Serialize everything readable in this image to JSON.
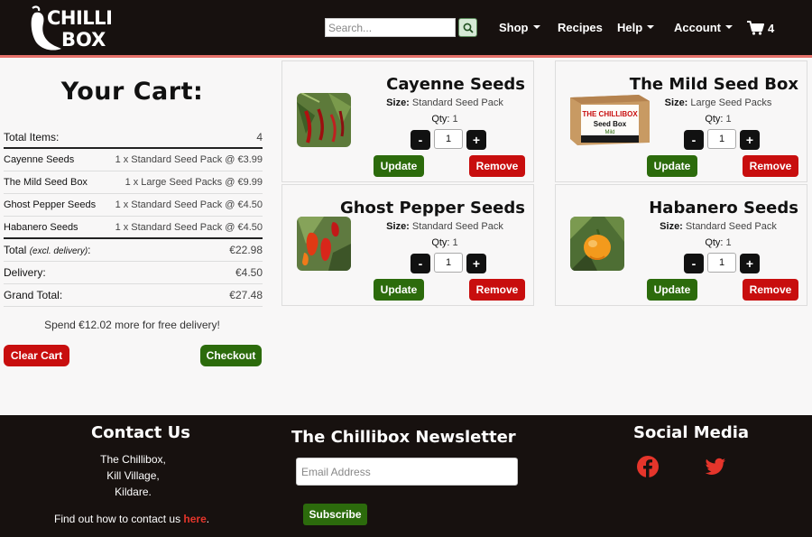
{
  "brand": {
    "logo_top": "CHILLI",
    "logo_bottom": "BOX"
  },
  "search": {
    "placeholder": "Search..."
  },
  "nav": {
    "shop": "Shop",
    "recipes": "Recipes",
    "help": "Help",
    "account": "Account",
    "cart_count": "4"
  },
  "cart": {
    "title": "Your Cart:",
    "total_items_label": "Total Items:",
    "total_items": "4",
    "lines": [
      {
        "name": "Cayenne Seeds",
        "detail": "1 x Standard Seed Pack @ €3.99"
      },
      {
        "name": "The Mild Seed Box",
        "detail": "1 x Large Seed Packs @ €9.99"
      },
      {
        "name": "Ghost Pepper Seeds",
        "detail": "1 x Standard Seed Pack @ €4.50"
      },
      {
        "name": "Habanero Seeds",
        "detail": "1 x Standard Seed Pack @ €4.50"
      }
    ],
    "total_label": "Total",
    "total_note": "(excl. delivery)",
    "total_suffix": ":",
    "total": "€22.98",
    "delivery_label": "Delivery:",
    "delivery": "€4.50",
    "grand_label": "Grand Total:",
    "grand": "€27.48",
    "free_delivery_msg": "Spend €12.02 more for free delivery!",
    "clear_label": "Clear Cart",
    "checkout_label": "Checkout"
  },
  "products": [
    {
      "name": "Cayenne Seeds",
      "size_label": "Size:",
      "size": "Standard Seed Pack",
      "qty_label": "Qty:",
      "qty": "1",
      "qty_input": "1",
      "minus": "-",
      "plus": "+",
      "update": "Update",
      "remove": "Remove"
    },
    {
      "name": "The Mild Seed Box",
      "size_label": "Size:",
      "size": "Large Seed Packs",
      "qty_label": "Qty:",
      "qty": "1",
      "qty_input": "1",
      "minus": "-",
      "plus": "+",
      "update": "Update",
      "remove": "Remove",
      "box_title": "THE CHILLIBOX",
      "box_sub": "Seed Box",
      "box_tag": "Mild"
    },
    {
      "name": "Ghost Pepper Seeds",
      "size_label": "Size:",
      "size": "Standard Seed Pack",
      "qty_label": "Qty:",
      "qty": "1",
      "qty_input": "1",
      "minus": "-",
      "plus": "+",
      "update": "Update",
      "remove": "Remove"
    },
    {
      "name": "Habanero Seeds",
      "size_label": "Size:",
      "size": "Standard Seed Pack",
      "qty_label": "Qty:",
      "qty": "1",
      "qty_input": "1",
      "minus": "-",
      "plus": "+",
      "update": "Update",
      "remove": "Remove"
    }
  ],
  "footer": {
    "contact_title": "Contact Us",
    "address": [
      "The Chillibox,",
      "Kill Village,",
      "Kildare."
    ],
    "contact_prefix": "Find out how to contact us ",
    "contact_link": "here",
    "contact_suffix": ".",
    "newsletter_title": "The Chillibox Newsletter",
    "email_placeholder": "Email Address",
    "subscribe": "Subscribe",
    "social_title": "Social Media",
    "social_icons": [
      "facebook-icon",
      "twitter-icon"
    ]
  },
  "colors": {
    "header_bg": "#17110f",
    "accent_red": "#c80e0e",
    "accent_green": "#2c6b0c",
    "header_border": "#e5716a"
  }
}
